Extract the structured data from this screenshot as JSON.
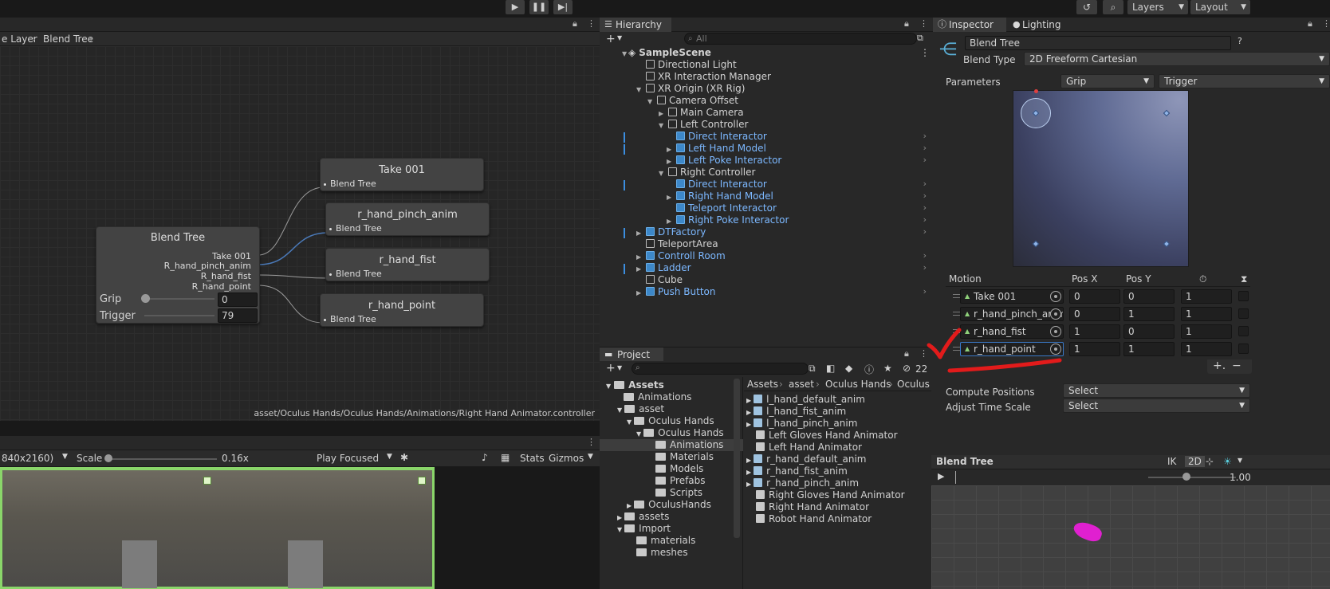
{
  "toolbar": {
    "layers_label": "Layers",
    "layout_label": "Layout"
  },
  "animator": {
    "breadcrumb": [
      "e Layer",
      "Blend Tree"
    ],
    "path": "asset/Oculus Hands/Oculus Hands/Animations/Right Hand Animator.controller",
    "blend_tree_node": {
      "title": "Blend Tree",
      "outputs": [
        "Take 001",
        "R_hand_pinch_anim",
        "R_hand_fist",
        "R_hand_point"
      ],
      "params": [
        {
          "name": "Grip",
          "value": "0"
        },
        {
          "name": "Trigger",
          "value": "79"
        }
      ]
    },
    "child_nodes": [
      {
        "title": "Take 001",
        "sub": "Blend Tree"
      },
      {
        "title": "r_hand_pinch_anim",
        "sub": "Blend Tree"
      },
      {
        "title": "r_hand_fist",
        "sub": "Blend Tree"
      },
      {
        "title": "r_hand_point",
        "sub": "Blend Tree"
      }
    ]
  },
  "game_view": {
    "resolution": "840x2160)",
    "scale_label": "Scale",
    "scale_value": "0.16x",
    "play_mode": "Play Focused",
    "stats": "Stats",
    "gizmos": "Gizmos"
  },
  "hierarchy": {
    "tab": "Hierarchy",
    "search_placeholder": "All",
    "items": [
      {
        "label": "SampleScene"
      },
      {
        "label": "Directional Light"
      },
      {
        "label": "XR Interaction Manager"
      },
      {
        "label": "XR Origin (XR Rig)"
      },
      {
        "label": "Camera Offset"
      },
      {
        "label": "Main Camera"
      },
      {
        "label": "Left Controller"
      },
      {
        "label": "Direct Interactor"
      },
      {
        "label": "Left Hand Model"
      },
      {
        "label": "Left Poke Interactor"
      },
      {
        "label": "Right Controller"
      },
      {
        "label": "Direct Interactor"
      },
      {
        "label": "Right Hand Model"
      },
      {
        "label": "Teleport Interactor"
      },
      {
        "label": "Right Poke Interactor"
      },
      {
        "label": "DTFactory"
      },
      {
        "label": "TeleportArea"
      },
      {
        "label": "Controll Room"
      },
      {
        "label": "Ladder"
      },
      {
        "label": "Cube"
      },
      {
        "label": "Push Button"
      }
    ]
  },
  "project": {
    "tab": "Project",
    "hidden_count": "22",
    "tree": [
      "Assets",
      "Animations",
      "asset",
      "Oculus Hands",
      "Oculus Hands",
      "Animations",
      "Materials",
      "Models",
      "Prefabs",
      "Scripts",
      "OculusHands",
      "assets",
      "Import",
      "materials",
      "meshes"
    ],
    "breadcrumb": [
      "Assets",
      "asset",
      "Oculus Hands",
      "Oculus H"
    ],
    "files": [
      "l_hand_default_anim",
      "l_hand_fist_anim",
      "l_hand_pinch_anim",
      "Left Gloves Hand Animator",
      "Left Hand Animator",
      "r_hand_default_anim",
      "r_hand_fist_anim",
      "r_hand_pinch_anim",
      "Right Gloves Hand Animator",
      "Right Hand Animator",
      "Robot Hand Animator"
    ]
  },
  "inspector": {
    "tabs": [
      "Inspector",
      "Lighting"
    ],
    "name": "Blend Tree",
    "blend_type_label": "Blend Type",
    "blend_type": "2D Freeform Cartesian",
    "parameters_label": "Parameters",
    "param_x": "Grip",
    "param_y": "Trigger",
    "columns": [
      "Motion",
      "Pos X",
      "Pos Y"
    ],
    "motions": [
      {
        "name": "Take 001",
        "x": "0",
        "y": "0",
        "speed": "1"
      },
      {
        "name": "r_hand_pinch_anim",
        "x": "0",
        "y": "1",
        "speed": "1"
      },
      {
        "name": "r_hand_fist",
        "x": "1",
        "y": "0",
        "speed": "1"
      },
      {
        "name": "r_hand_point",
        "x": "1",
        "y": "1",
        "speed": "1"
      }
    ],
    "compute_label": "Compute Positions",
    "compute_value": "Select",
    "adjust_label": "Adjust Time Scale",
    "adjust_value": "Select",
    "preview_title": "Blend Tree",
    "ik": "IK",
    "mode2d": "2D",
    "time": "1.00"
  }
}
